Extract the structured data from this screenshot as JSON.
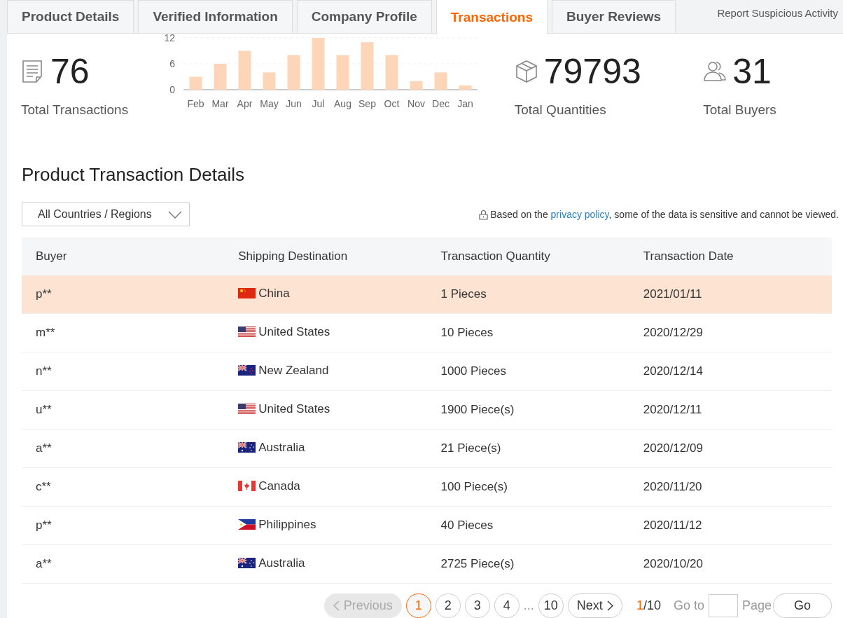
{
  "tabs": [
    {
      "label": "Product Details",
      "selected": false
    },
    {
      "label": "Verified Information",
      "selected": false
    },
    {
      "label": "Company Profile",
      "selected": false
    },
    {
      "label": "Transactions",
      "selected": true
    },
    {
      "label": "Buyer Reviews",
      "selected": false
    }
  ],
  "report_link": "Report Suspicious Activity",
  "stats": [
    {
      "kind": "transactions",
      "value": "76",
      "label": "Total Transactions"
    },
    {
      "kind": "chart"
    },
    {
      "kind": "quantities",
      "value": "79793",
      "label": "Total Quantities"
    },
    {
      "kind": "buyers",
      "value": "31",
      "label": "Total Buyers"
    }
  ],
  "chart_data": {
    "type": "bar",
    "categories": [
      "Feb",
      "Mar",
      "Apr",
      "May",
      "Jun",
      "Jul",
      "Aug",
      "Sep",
      "Oct",
      "Nov",
      "Dec",
      "Jan"
    ],
    "series": [
      {
        "color": "#fdd5b8",
        "values": [
          3,
          6,
          9,
          4,
          8,
          12,
          8,
          11,
          8,
          2,
          4,
          1
        ]
      }
    ],
    "ylim": [
      0,
      12
    ],
    "yticks": [
      0,
      6,
      12
    ]
  },
  "section_title": "Product Transaction Details",
  "country_filter": "All Countries / Regions",
  "privacy_note": {
    "before": "Based on the ",
    "link": "privacy policy",
    "after": ", some of the data is sensitive and cannot be viewed."
  },
  "table": {
    "columns": [
      "Buyer",
      "Shipping Destination",
      "Transaction Quantity",
      "Transaction Date"
    ],
    "rows": [
      {
        "buyer": "p**",
        "kind": "cn",
        "destination": "China",
        "quantity": "1 Pieces",
        "date": "2021/01/11",
        "highlighted": true
      },
      {
        "buyer": "m**",
        "kind": "us",
        "destination": "United States",
        "quantity": "10 Pieces",
        "date": "2020/12/29",
        "highlighted": false
      },
      {
        "buyer": "n**",
        "kind": "nz",
        "destination": "New Zealand",
        "quantity": "1000 Pieces",
        "date": "2020/12/14",
        "highlighted": false
      },
      {
        "buyer": "u**",
        "kind": "us",
        "destination": "United States",
        "quantity": "1900 Piece(s)",
        "date": "2020/12/11",
        "highlighted": false
      },
      {
        "buyer": "a**",
        "kind": "au",
        "destination": "Australia",
        "quantity": "21 Piece(s)",
        "date": "2020/12/09",
        "highlighted": false
      },
      {
        "buyer": "c**",
        "kind": "ca",
        "destination": "Canada",
        "quantity": "100 Piece(s)",
        "date": "2020/11/20",
        "highlighted": false
      },
      {
        "buyer": "p**",
        "kind": "ph",
        "destination": "Philippines",
        "quantity": "40 Pieces",
        "date": "2020/11/12",
        "highlighted": false
      },
      {
        "buyer": "a**",
        "kind": "au",
        "destination": "Australia",
        "quantity": "2725 Piece(s)",
        "date": "2020/10/20",
        "highlighted": false
      }
    ]
  },
  "pagination": {
    "previous": {
      "label": "Previous",
      "disabled": true
    },
    "pages": [
      {
        "label": "1",
        "selected": true
      },
      {
        "label": "2",
        "selected": false
      },
      {
        "label": "3",
        "selected": false
      },
      {
        "label": "4",
        "selected": false
      },
      {
        "label": "10",
        "selected": false
      }
    ],
    "ellipsis": "...",
    "next": {
      "label": "Next",
      "disabled": false
    },
    "current": "1",
    "total": "/10",
    "goto_label": "Go to",
    "page_label": "Page",
    "go_button": "Go"
  }
}
